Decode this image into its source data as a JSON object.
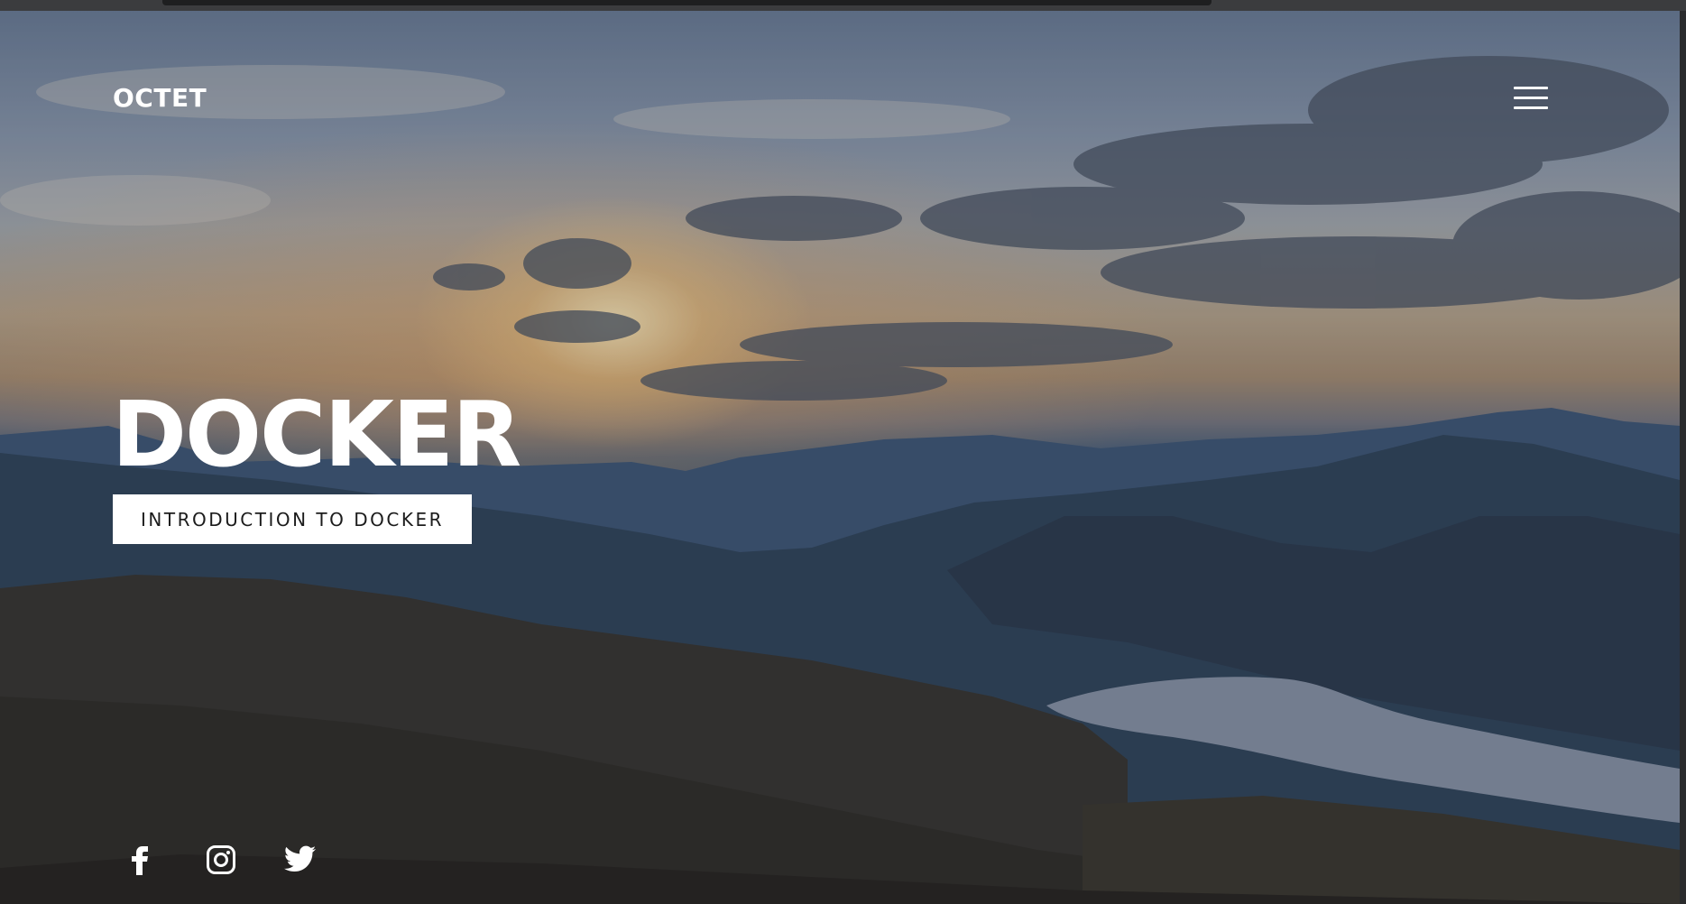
{
  "header": {
    "brand": "OCTET",
    "menu_icon": "hamburger-menu-icon"
  },
  "hero": {
    "title": "DOCKER",
    "cta_label": "INTRODUCTION TO DOCKER",
    "background": "mountain-sunset-landscape"
  },
  "social": [
    {
      "name": "facebook",
      "icon": "facebook-icon"
    },
    {
      "name": "instagram",
      "icon": "instagram-icon"
    },
    {
      "name": "twitter",
      "icon": "twitter-icon"
    }
  ],
  "colors": {
    "text": "#ffffff",
    "button_bg": "#ffffff",
    "button_text": "#1c1c1c"
  }
}
